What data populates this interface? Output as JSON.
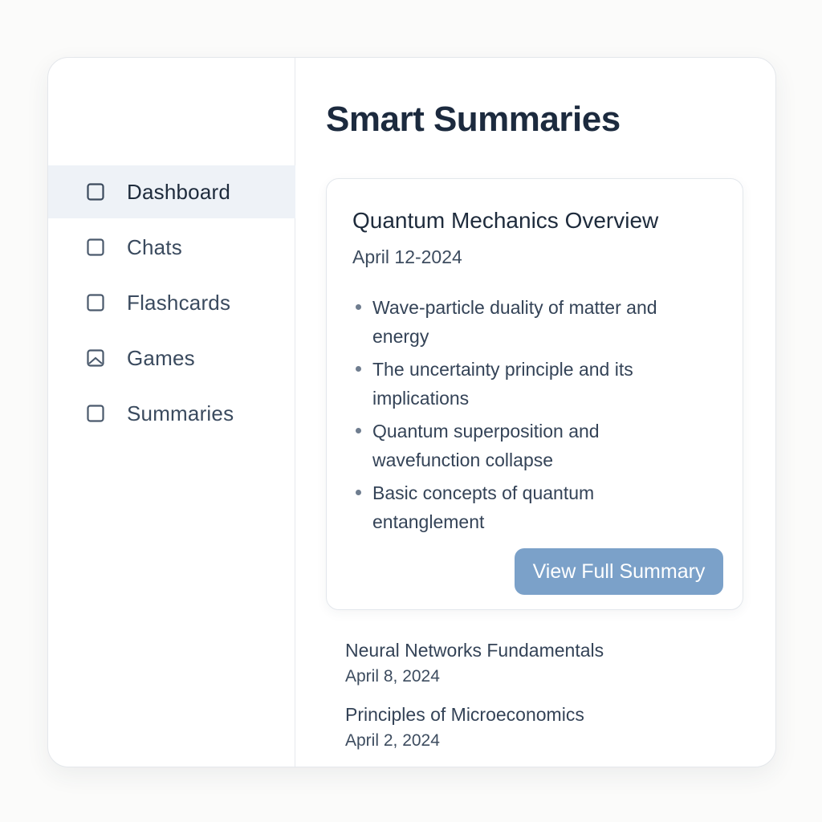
{
  "sidebar": {
    "items": [
      {
        "label": "Dashboard",
        "icon": "square-icon",
        "active": true
      },
      {
        "label": "Chats",
        "icon": "square-icon"
      },
      {
        "label": "Flashcards",
        "icon": "square-icon"
      },
      {
        "label": "Games",
        "icon": "image-icon"
      },
      {
        "label": "Summaries",
        "icon": "square-icon"
      }
    ]
  },
  "main": {
    "title": "Smart Summaries",
    "featured": {
      "title": "Quantum Mechanics Overview",
      "date": "April 12-2024",
      "bullets": [
        "Wave-particle duality of matter and energy",
        "The uncertainty principle and its implications",
        "Quantum superposition and wavefunction collapse",
        "Basic concepts of quantum entanglement"
      ],
      "button_label": "View Full Summary"
    },
    "recent": [
      {
        "title": "Neural Networks Fundamentals",
        "date": "April 8, 2024"
      },
      {
        "title": "Principles of Microeconomics",
        "date": "April 2, 2024"
      }
    ]
  },
  "colors": {
    "background": "#fbfbfa",
    "active_nav": "#eef2f7",
    "button": "#7ba1c9",
    "title_text": "#1c2a3e",
    "body_text": "#344357"
  }
}
